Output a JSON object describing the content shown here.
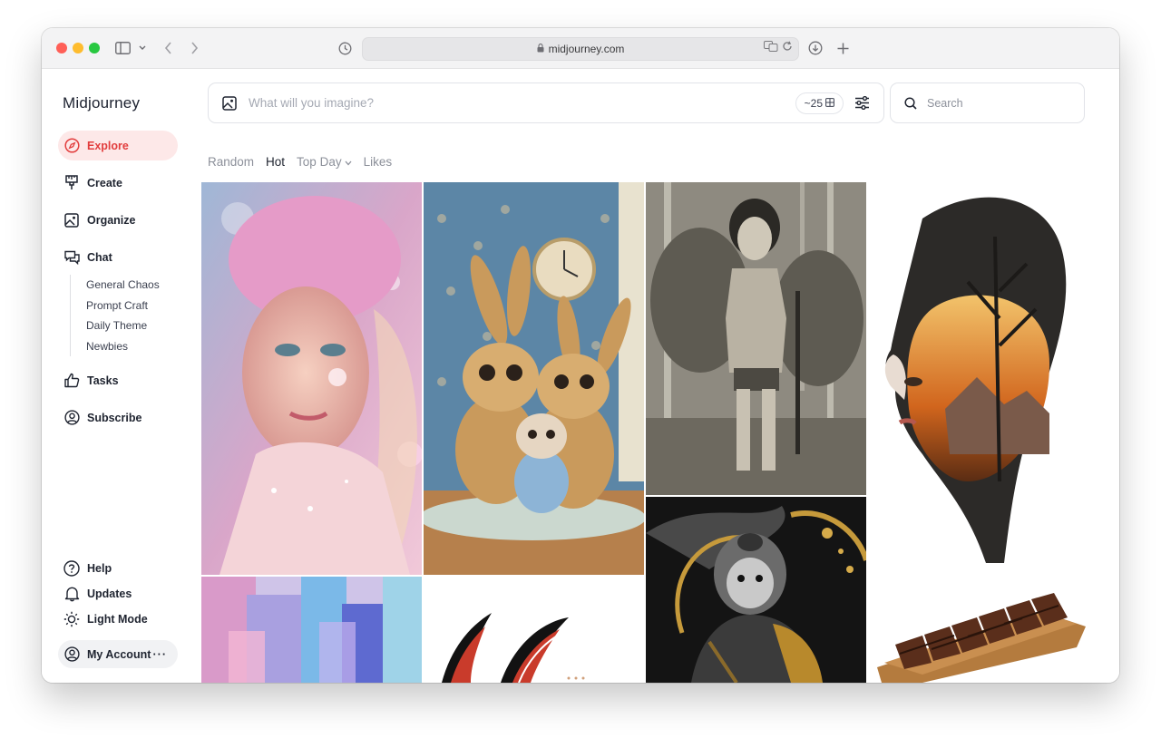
{
  "browser": {
    "url": "midjourney.com"
  },
  "app": {
    "brand": "Midjourney"
  },
  "sidebar": {
    "items": [
      {
        "label": "Explore",
        "icon": "compass-icon",
        "active": true
      },
      {
        "label": "Create",
        "icon": "brush-icon"
      },
      {
        "label": "Organize",
        "icon": "image-icon"
      },
      {
        "label": "Chat",
        "icon": "chat-icon"
      },
      {
        "label": "Tasks",
        "icon": "thumbs-up-icon"
      },
      {
        "label": "Subscribe",
        "icon": "user-circle-icon"
      }
    ],
    "chat_channels": [
      "General Chaos",
      "Prompt Craft",
      "Daily Theme",
      "Newbies"
    ],
    "bottom": [
      {
        "label": "Help",
        "icon": "help-icon"
      },
      {
        "label": "Updates",
        "icon": "bell-icon"
      },
      {
        "label": "Light Mode",
        "icon": "sun-icon"
      }
    ],
    "account": {
      "label": "My Account",
      "more": "···"
    }
  },
  "prompt": {
    "placeholder": "What will you imagine?",
    "credits": "~25"
  },
  "search": {
    "placeholder": "Search"
  },
  "filters": {
    "items": [
      "Random",
      "Hot",
      "Top Day",
      "Likes"
    ],
    "selected": "Hot"
  },
  "gallery": {
    "images": [
      "pink-haired-fairy-portrait",
      "cartoon-rabbit-family",
      "vintage-photo-woman-forest",
      "double-exposure-face-tree",
      "abstract-pastel-brushstrokes",
      "black-red-curved-shapes",
      "samurai-monkey-gold-ink",
      "grilled-meat-on-board"
    ]
  },
  "colors": {
    "accent": "#e23d3d",
    "active_bg": "#fde8e8"
  }
}
